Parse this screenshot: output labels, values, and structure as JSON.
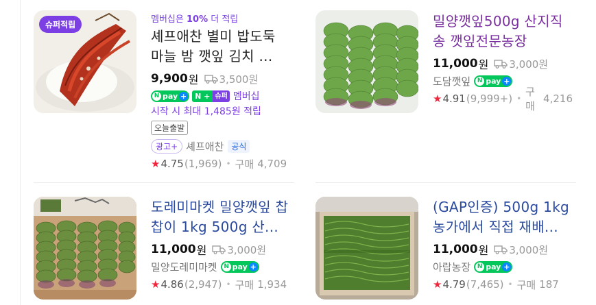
{
  "products": [
    {
      "badge": "슈퍼적립",
      "promo_prefix": "멤버십은 ",
      "promo_pct": "10%",
      "promo_suffix": " 더 적립",
      "title": "셰프애찬 별미 밥도둑 마늘 밤 깻잎 김치 ...",
      "price": "9,900",
      "won": "원",
      "shipping": "3,500원",
      "benefit_npay_n": "N",
      "benefit_npay": "pay",
      "benefit_plus": "+",
      "benefit_nplus": "N +",
      "benefit_super": "슈퍼",
      "membership": "멤버십",
      "reward": "시작 시 최대 1,485원 적립",
      "tag": "오늘출발",
      "ad": "광고+",
      "seller": "셰프애찬",
      "official": "공식",
      "rating": "4.75",
      "rating_count": "(1,969)",
      "buy_label": "구매",
      "buy_count": "4,709",
      "image": "kimchi-leaf-photo"
    },
    {
      "title": "밀양깻잎500g 산지직송 깻잎전문농장",
      "price": "11,000",
      "won": "원",
      "shipping": "3,000원",
      "seller": "도담깻잎",
      "npay_n": "N",
      "npay": "pay",
      "plus": "+",
      "rating": "4.91",
      "rating_count": "(9,999+)",
      "buy_label": "구매",
      "buy_count": "4,216",
      "image": "perilla-leaves-photo"
    },
    {
      "title": "도레미마켓 밀양깻잎 찹찹이 1kg 500g 산...",
      "price": "11,000",
      "won": "원",
      "shipping": "3,000원",
      "seller": "밀양도레미마켓",
      "npay_n": "N",
      "npay": "pay",
      "plus": "+",
      "rating": "4.86",
      "rating_count": "(2,947)",
      "buy_label": "구매",
      "buy_count": "1,934",
      "image": "perilla-box-photo"
    },
    {
      "title": "(GAP인증) 500g 1kg 농가에서 직접 재배...",
      "price": "11,000",
      "won": "원",
      "shipping": "3,000원",
      "seller": "아랍농장",
      "npay_n": "N",
      "npay": "pay",
      "plus": "+",
      "rating": "4.79",
      "rating_count": "(7,465)",
      "buy_label": "구매",
      "buy_count": "187",
      "image": "perilla-crate-photo"
    }
  ],
  "colors": {
    "accent_purple": "#7b3fe4",
    "npay_green": "#03c75a",
    "star_red": "#f0263c",
    "link_blue": "#2b4a9e",
    "visited_purple": "#7a2f9e"
  },
  "icons": {
    "shipping": "truck-icon",
    "star": "star-icon",
    "plus": "plus-icon"
  }
}
